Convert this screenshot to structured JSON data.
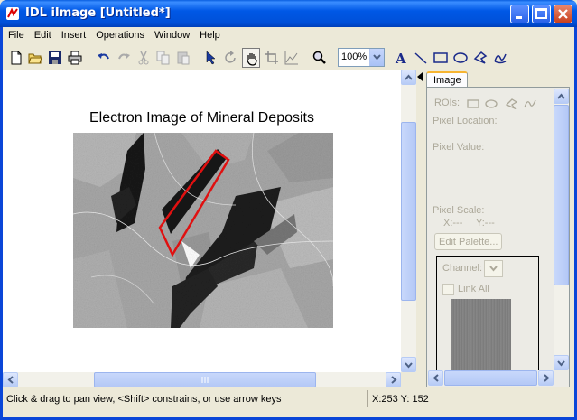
{
  "window": {
    "title": "IDL iImage [Untitled*]"
  },
  "menu": {
    "items": [
      "File",
      "Edit",
      "Insert",
      "Operations",
      "Window",
      "Help"
    ]
  },
  "toolbar": {
    "icons": [
      "new-file",
      "open-folder",
      "save-disk",
      "print",
      "undo",
      "redo",
      "cut",
      "copy",
      "paste",
      "select-arrow",
      "rotate",
      "pan-hand",
      "crop",
      "line-profile",
      "zoom-magnifier",
      "text-tool",
      "line-tool",
      "rectangle-tool",
      "oval-tool",
      "polygon-tool",
      "freehand-tool"
    ],
    "zoom_value": "100%"
  },
  "canvas": {
    "image_title": "Electron Image of Mineral Deposits",
    "roi_color": "#e01010"
  },
  "panel": {
    "tab_label": "Image",
    "rois_label": "ROIs:",
    "pixel_location_label": "Pixel Location:",
    "pixel_value_label": "Pixel Value:",
    "pixel_scale_label": "Pixel Scale:",
    "pixel_scale_x": "X:---",
    "pixel_scale_y": "Y:---",
    "edit_palette_label": "Edit Palette...",
    "channel_label": "Channel:",
    "link_all_label": "Link All"
  },
  "status": {
    "message": "Click & drag to pan view, <Shift> constrains, or use arrow keys",
    "coordinates": "X:253  Y: 152"
  },
  "colors": {
    "titlebar": "#0058e6",
    "chrome": "#ece9d8",
    "accent_tab": "#f7b531"
  }
}
